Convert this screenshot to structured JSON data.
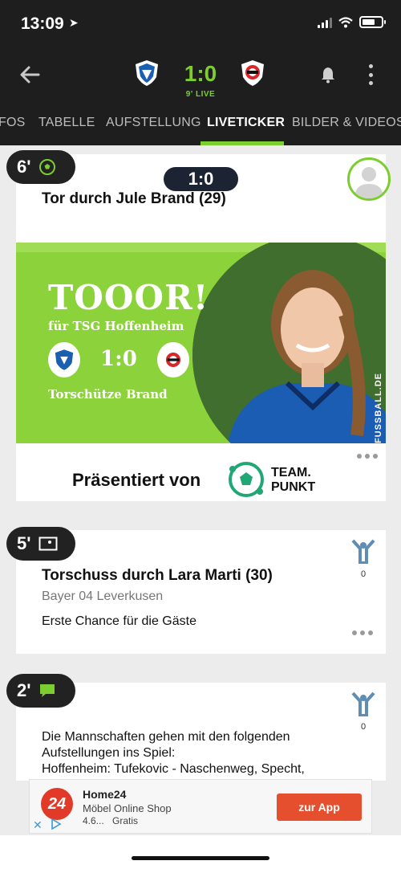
{
  "status_bar": {
    "time": "13:09"
  },
  "match_header": {
    "score": "1:0",
    "live_label": "9' LIVE",
    "home_team": "TSG Hoffenheim",
    "away_team": "Bayer 04 Leverkusen"
  },
  "tabs": [
    {
      "label": "FOS"
    },
    {
      "label": "TABELLE"
    },
    {
      "label": "AUFSTELLUNG"
    },
    {
      "label": "LIVETICKER",
      "active": true
    },
    {
      "label": "BILDER & VIDEOS"
    }
  ],
  "colors": {
    "accent": "#7ccd2f",
    "header_bg": "#1e1e1e",
    "banner_green": "#8cd23a",
    "ad_button": "#e64f2e"
  },
  "feed": {
    "goal": {
      "minute": "6'",
      "score": "1:0",
      "title": "Tor durch Jule Brand (29)",
      "banner": {
        "headline": "TOOOR!",
        "subline": "für TSG Hoffenheim",
        "score": "1:0",
        "scorer": "Torschütze Brand",
        "watermark": "FUSSBALL.DE"
      },
      "presented_by": "Präsentiert von",
      "sponsor_line1": "TEAM.",
      "sponsor_line2": "PUNKT"
    },
    "shot": {
      "minute": "5'",
      "title": "Torschuss durch Lara Marti (30)",
      "team": "Bayer 04 Leverkusen",
      "description": "Erste Chance für die Gäste",
      "reactions": "0"
    },
    "info": {
      "minute": "2'",
      "text_line1": "Die Mannschaften gehen mit den folgenden",
      "text_line2": "Aufstellungen ins Spiel:",
      "text_line3": "Hoffenheim: Tufekovic - Naschenweg, Specht,",
      "reactions": "0"
    }
  },
  "ad": {
    "logo_text": "24",
    "title": "Home24",
    "subtitle": "Möbel Online Shop",
    "rating": "4.6...",
    "price": "Gratis",
    "button": "zur App"
  }
}
